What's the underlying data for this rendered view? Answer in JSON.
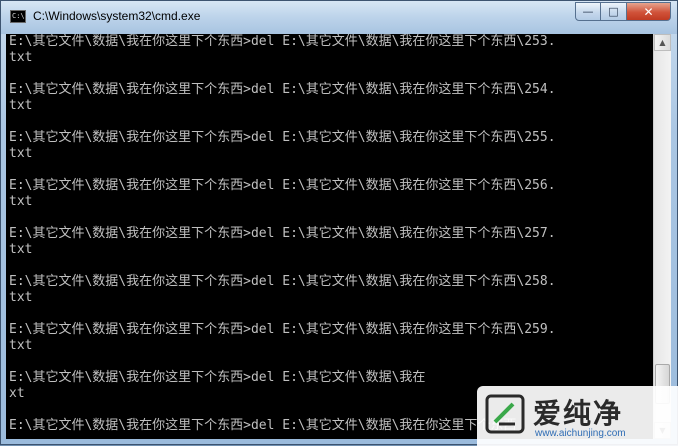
{
  "window": {
    "title": "C:\\Windows\\system32\\cmd.exe",
    "icon": "cmd-icon",
    "buttons": {
      "minimize": "—",
      "maximize": "□",
      "close": "✕"
    }
  },
  "console": {
    "lines": [
      "E:\\其它文件\\数据\\我在你这里下个东西>del E:\\其它文件\\数据\\我在你这里下个东西\\253.",
      "txt",
      "",
      "E:\\其它文件\\数据\\我在你这里下个东西>del E:\\其它文件\\数据\\我在你这里下个东西\\254.",
      "txt",
      "",
      "E:\\其它文件\\数据\\我在你这里下个东西>del E:\\其它文件\\数据\\我在你这里下个东西\\255.",
      "txt",
      "",
      "E:\\其它文件\\数据\\我在你这里下个东西>del E:\\其它文件\\数据\\我在你这里下个东西\\256.",
      "txt",
      "",
      "E:\\其它文件\\数据\\我在你这里下个东西>del E:\\其它文件\\数据\\我在你这里下个东西\\257.",
      "txt",
      "",
      "E:\\其它文件\\数据\\我在你这里下个东西>del E:\\其它文件\\数据\\我在你这里下个东西\\258.",
      "txt",
      "",
      "E:\\其它文件\\数据\\我在你这里下个东西>del E:\\其它文件\\数据\\我在你这里下个东西\\259.",
      "txt",
      "",
      "E:\\其它文件\\数据\\我在你这里下个东西>del E:\\其它文件\\数据\\我在",
      "xt",
      "",
      "E:\\其它文件\\数据\\我在你这里下个东西>del E:\\其它文件\\数据\\我在你这里下个东西"
    ]
  },
  "watermark": {
    "brand": "爱纯净",
    "url": "www.aichunjing.com"
  },
  "colors": {
    "console_bg": "#000000",
    "console_text": "#c0c0c0",
    "close_button": "#c94a32"
  }
}
